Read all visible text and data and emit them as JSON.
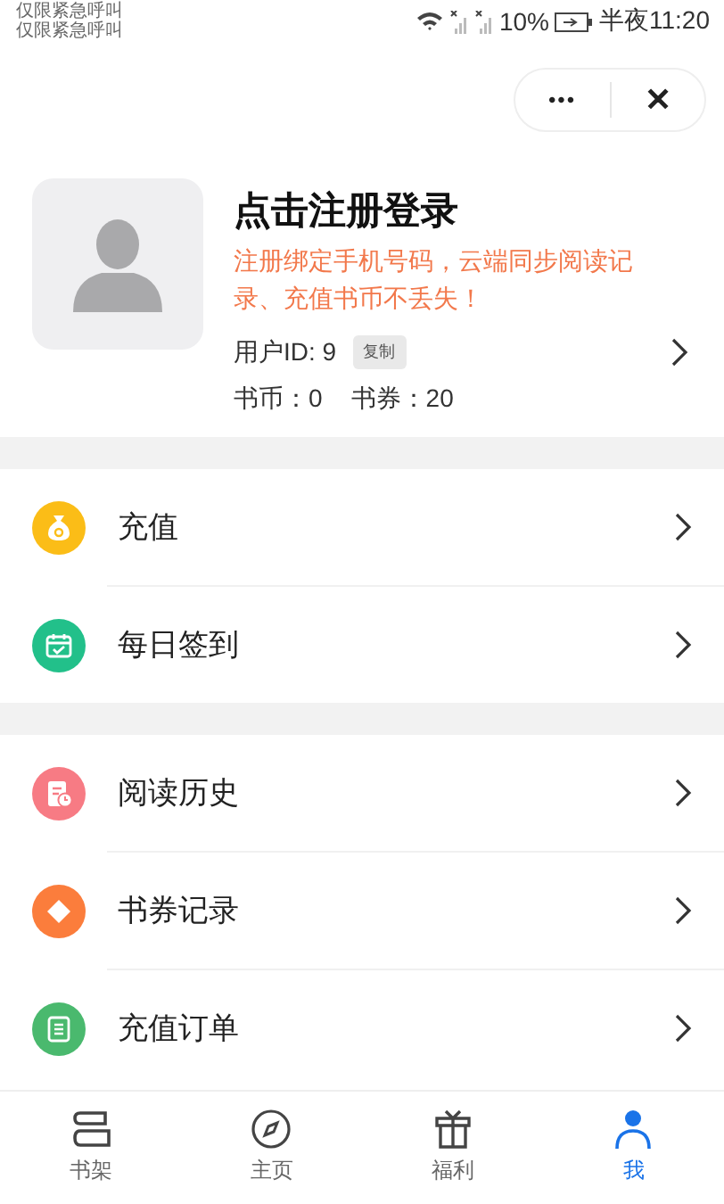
{
  "status_bar": {
    "carrier_lines": [
      "仅限紧急呼叫",
      "仅限紧急呼叫"
    ],
    "battery": "10%",
    "time": "半夜11:20"
  },
  "capsule": {
    "more": "•••",
    "close": "✕"
  },
  "profile": {
    "title": "点击注册登录",
    "notice": "注册绑定手机号码，云端同步阅读记录、充值书币不丢失！",
    "user_id": "用户ID: 9",
    "copy_button": "复制",
    "coins": "书币：0",
    "vouchers": "书券：20"
  },
  "menu_groups": [
    {
      "items": [
        {
          "label": "充值",
          "kind": "moneybag",
          "color": "#fbbd17"
        },
        {
          "label": "每日签到",
          "kind": "calendar",
          "color": "#22c08a"
        }
      ]
    },
    {
      "items": [
        {
          "label": "阅读历史",
          "kind": "history",
          "color": "#f77b84"
        },
        {
          "label": "书券记录",
          "kind": "voucher",
          "color": "#fb7d3c"
        },
        {
          "label": "充值订单",
          "kind": "order",
          "color": "#4ab96e"
        }
      ]
    }
  ],
  "tab_bar": [
    {
      "label": "书架",
      "kind": "shelf",
      "selected": false
    },
    {
      "label": "主页",
      "kind": "compass",
      "selected": false
    },
    {
      "label": "福利",
      "kind": "gift",
      "selected": false
    },
    {
      "label": "我",
      "kind": "person",
      "selected": true
    }
  ]
}
